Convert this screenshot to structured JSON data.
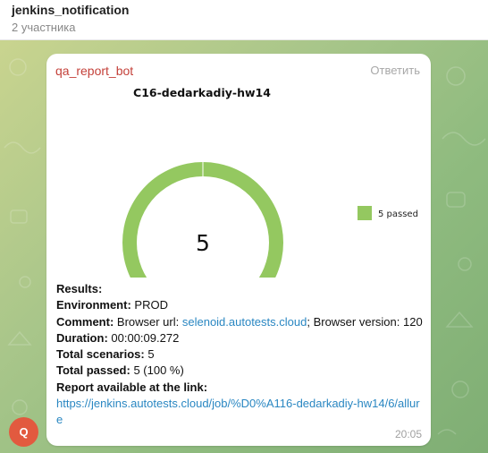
{
  "header": {
    "title": "jenkins_notification",
    "subtitle": "2 участника"
  },
  "message": {
    "sender": "qa_report_bot",
    "reply_label": "Ответить",
    "time": "20:05",
    "avatar_letter": "Q",
    "body": {
      "results_label": "Results:",
      "environment_label": "Environment:",
      "environment_value": " PROD",
      "comment_label": "Comment:",
      "comment_text_pre": " Browser url: ",
      "comment_link": "selenoid.autotests.cloud",
      "comment_text_post": "; Browser version: 120",
      "duration_label": "Duration:",
      "duration_value": " 00:00:09.272",
      "total_scenarios_label": "Total scenarios:",
      "total_scenarios_value": " 5",
      "total_passed_label": "Total passed:",
      "total_passed_value": " 5 (100 %)",
      "report_label": "Report available at the link:",
      "report_link": "https://jenkins.autotests.cloud/job/%D0%A116-dedarkadiy-hw14/6/allure"
    }
  },
  "chart_data": {
    "type": "pie",
    "title": "C16-dedarkadiy-hw14",
    "center_label": "5",
    "categories": [
      "5 passed"
    ],
    "values": [
      5
    ],
    "colors": [
      "#94c860"
    ],
    "legend_position": "right"
  }
}
